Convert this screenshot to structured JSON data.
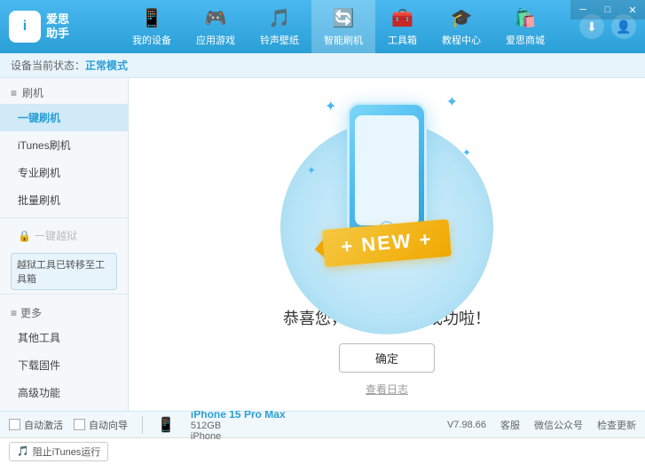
{
  "app": {
    "title": "爱思助手",
    "logo_char": "i",
    "logo_line1": "爱思",
    "logo_line2": "助手"
  },
  "window_controls": {
    "minimize": "─",
    "maximize": "□",
    "close": "✕"
  },
  "nav": {
    "items": [
      {
        "id": "my-device",
        "label": "我的设备",
        "icon": "📱"
      },
      {
        "id": "apps-games",
        "label": "应用游戏",
        "icon": "🎮"
      },
      {
        "id": "ringtone-wallpaper",
        "label": "铃声壁纸",
        "icon": "🎵"
      },
      {
        "id": "smart-flash",
        "label": "智能刷机",
        "icon": "🔄"
      },
      {
        "id": "toolbox",
        "label": "工具箱",
        "icon": "🧰"
      },
      {
        "id": "tutorial",
        "label": "教程中心",
        "icon": "🎓"
      },
      {
        "id": "shop",
        "label": "爱思商城",
        "icon": "🛍️"
      }
    ],
    "active": "smart-flash"
  },
  "sub_header": {
    "prefix": "设备当前状态：",
    "status": "正常模式"
  },
  "sidebar": {
    "group1_title": "刷机",
    "items": [
      {
        "id": "one-click-flash",
        "label": "一键刷机",
        "active": true
      },
      {
        "id": "itunes-flash",
        "label": "iTunes刷机",
        "active": false
      },
      {
        "id": "pro-flash",
        "label": "专业刷机",
        "active": false
      },
      {
        "id": "batch-flash",
        "label": "批量刷机",
        "active": false
      }
    ],
    "lock_item": "一键越狱",
    "tool_tip": "越狱工具已转移至\n工具箱",
    "more_title": "更多",
    "more_items": [
      {
        "id": "other-tools",
        "label": "其他工具"
      },
      {
        "id": "download-fw",
        "label": "下载固件"
      },
      {
        "id": "advanced",
        "label": "高级功能"
      }
    ]
  },
  "content": {
    "new_label": "+ NEW +",
    "success_message": "恭喜您，保资料刷机成功啦！",
    "confirm_button": "确定",
    "view_log": "查看日志"
  },
  "bottom": {
    "auto_connect": "自动激活",
    "auto_nav": "自动向导",
    "device_icon": "📱",
    "device_name": "iPhone 15 Pro Max",
    "device_storage": "512GB",
    "device_type": "iPhone",
    "version": "V7.98.66",
    "support": "客服",
    "wechat": "微信公众号",
    "check_update": "检查更新"
  },
  "status_bar": {
    "itunes_label": "阻止iTunes运行"
  }
}
